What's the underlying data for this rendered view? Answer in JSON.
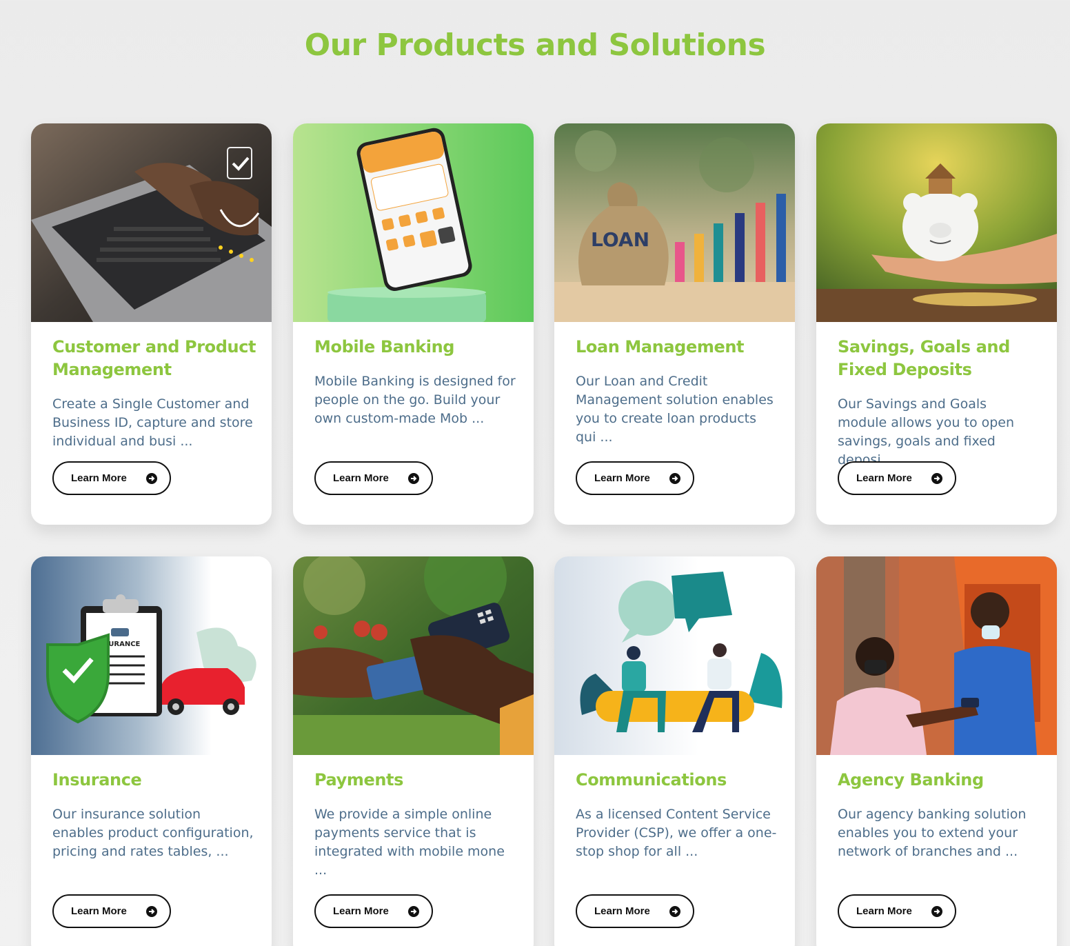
{
  "section": {
    "title": "Our Products and Solutions"
  },
  "cards": [
    {
      "title": "Customer and Product Management",
      "description": "Create a Single Customer and Business ID, capture and store individual and busi ...",
      "button": "Learn More",
      "image": "laptop-typing-rating-photo"
    },
    {
      "title": "Mobile Banking",
      "description": "Mobile Banking is designed for people on the go. Build your own custom-made Mob ...",
      "button": "Learn More",
      "image": "mobile-app-phone-photo"
    },
    {
      "title": "Loan Management",
      "description": "Our Loan and Credit Management solution enables you to create loan products qui ...",
      "button": "Learn More",
      "image": "loan-bag-bar-chart-photo",
      "image_text": "LOAN"
    },
    {
      "title": "Savings, Goals and Fixed Deposits",
      "description": "Our Savings and Goals module allows you to open savings, goals and fixed deposi ...",
      "button": "Learn More",
      "image": "piggy-bank-hand-photo"
    },
    {
      "title": "Insurance",
      "description": "Our insurance solution enables product configuration, pricing and rates tables, ...",
      "button": "Learn More",
      "image": "insurance-clipboard-car-illustration",
      "image_text": "INSURANCE"
    },
    {
      "title": "Payments",
      "description": "We provide a simple online payments service that is integrated with mobile mone ...",
      "button": "Learn More",
      "image": "card-payment-terminal-photo"
    },
    {
      "title": "Communications",
      "description": "As a licensed Content Service Provider (CSP), we offer a one-stop shop for all ...",
      "button": "Learn More",
      "image": "people-chatting-illustration"
    },
    {
      "title": "Agency Banking",
      "description": "Our agency banking solution enables you to extend your network of branches and ...",
      "button": "Learn More",
      "image": "agent-kiosk-photo"
    }
  ],
  "colors": {
    "accent": "#8dc63f",
    "body_text": "#4d6d8a",
    "button_border": "#111111"
  }
}
